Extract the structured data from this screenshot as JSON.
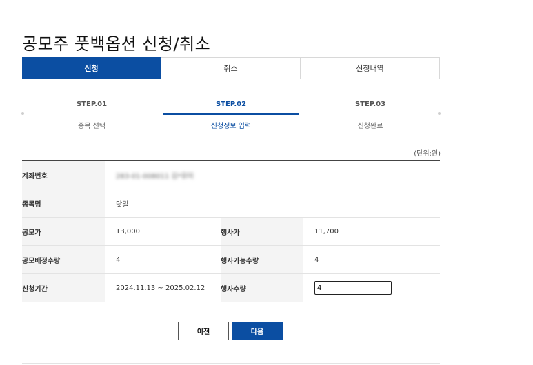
{
  "page": {
    "title": "공모주 풋백옵션 신청/취소"
  },
  "tabs": [
    {
      "label": "신청",
      "active": true
    },
    {
      "label": "취소",
      "active": false
    },
    {
      "label": "신청내역",
      "active": false
    }
  ],
  "steps": [
    {
      "num": "STEP.01",
      "label": "종목 선택"
    },
    {
      "num": "STEP.02",
      "label": "신청정보 입력",
      "active": true
    },
    {
      "num": "STEP.03",
      "label": "신청완료"
    }
  ],
  "unit_text": "(단위:원)",
  "table": {
    "account_label": "계좌번호",
    "account_value": "283-01-008011 김*뮤미",
    "stock_label": "종목명",
    "stock_value": "닷밀",
    "offer_price_label": "공모가",
    "offer_price_value": "13,000",
    "exercise_price_label": "행사가",
    "exercise_price_value": "11,700",
    "allot_qty_label": "공모배정수량",
    "allot_qty_value": "4",
    "exercisable_qty_label": "행사가능수량",
    "exercisable_qty_value": "4",
    "period_label": "신청기간",
    "period_value": "2024.11.13 ~ 2025.02.12",
    "exercise_qty_label": "행사수량",
    "exercise_qty_input": "4"
  },
  "buttons": {
    "prev": "이전",
    "next": "다음"
  },
  "colors": {
    "accent": "#0b4ea2",
    "header_bg": "#f4f4f4"
  }
}
